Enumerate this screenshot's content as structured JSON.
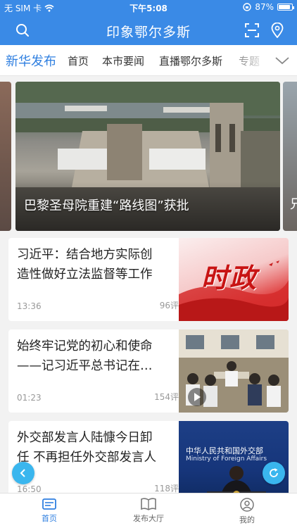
{
  "status": {
    "carrier": "无 SIM 卡",
    "time": "下午5:08",
    "battery": "87%"
  },
  "header": {
    "title": "印象鄂尔多斯"
  },
  "tabs": {
    "brand": "新华发布",
    "items": [
      "首页",
      "本市要闻",
      "直播鄂尔多斯",
      "专题"
    ]
  },
  "carousel": {
    "caption": "巴黎圣母院重建“路线图”获批",
    "side_caption": "兄"
  },
  "news": [
    {
      "line1": "习近平：结合地方实际创",
      "line2": "造性做好立法监督等工作",
      "time": "13:36",
      "comments": "96评",
      "thumb_text": "时政"
    },
    {
      "line1": "始终牢记党的初心和使命",
      "line2": "——记习近平总书记在…",
      "time": "01:23",
      "comments": "154评"
    },
    {
      "line1": "外交部发言人陆慷今日卸",
      "line2": "任 不再担任外交部发言人",
      "time": "16:50",
      "comments": "118评",
      "thumb_text": "中华人民共和国外交部",
      "thumb_subtext": "Ministry of Foreign Affairs"
    }
  ],
  "bottom_nav": {
    "home": "首页",
    "publish": "发布大厅",
    "mine": "我的"
  },
  "colors": {
    "primary": "#3a8ae6",
    "accent": "#2f7fe0",
    "fab": "#3ab6ee"
  }
}
